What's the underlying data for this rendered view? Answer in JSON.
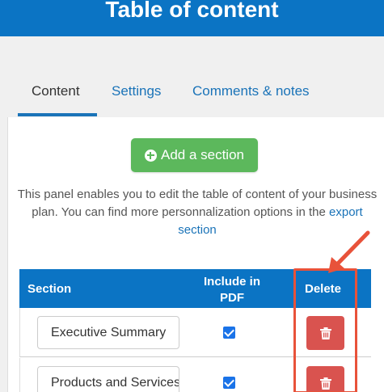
{
  "header": {
    "title": "Table of content"
  },
  "tabs": [
    {
      "label": "Content",
      "active": true
    },
    {
      "label": "Settings",
      "active": false
    },
    {
      "label": "Comments & notes",
      "active": false
    }
  ],
  "panel": {
    "add_button_label": "Add a section",
    "description_text": "This panel enables you to edit the table of content of your business plan. You can find more personnalization options in the",
    "description_link": "export section"
  },
  "table": {
    "columns": [
      "Section",
      "Include in PDF",
      "Delete"
    ],
    "rows": [
      {
        "section": "Executive Summary",
        "include": true
      },
      {
        "section": "Products and Services",
        "include": true
      }
    ]
  },
  "colors": {
    "header_bg": "#0b74c4",
    "accent": "#1a73b8",
    "add_button": "#5cb85c",
    "delete_button": "#d9534f",
    "annotation": "#e8523a"
  },
  "icons": {
    "add": "plus-circle-icon",
    "delete": "trash-icon"
  }
}
